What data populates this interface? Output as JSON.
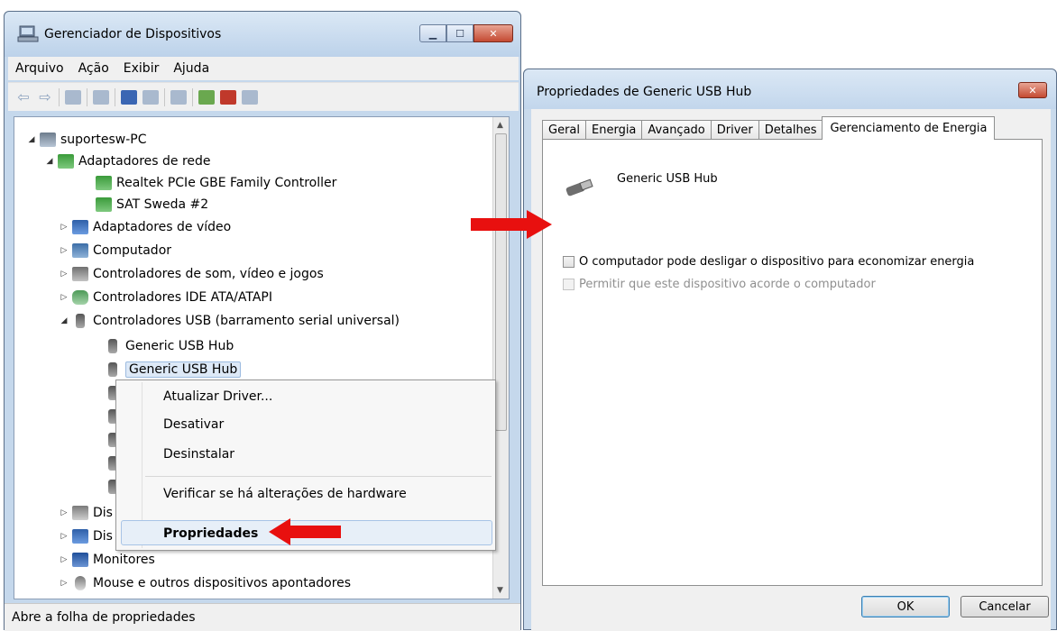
{
  "devmgr": {
    "title": "Gerenciador de Dispositivos",
    "menu": [
      "Arquivo",
      "Ação",
      "Exibir",
      "Ajuda"
    ],
    "tree": {
      "root": "suportesw-PC",
      "net_adapters": "Adaptadores de rede",
      "net_child1": "Realtek PCIe GBE Family Controller",
      "net_child2": "SAT Sweda #2",
      "video": "Adaptadores de vídeo",
      "computer": "Computador",
      "sound": "Controladores de som, vídeo e jogos",
      "ide": "Controladores IDE ATA/ATAPI",
      "usb": "Controladores USB (barramento serial universal)",
      "usb_child1": "Generic USB Hub",
      "usb_child2": "Generic USB Hub",
      "dis1": "Dis",
      "dis2": "Dis",
      "monitors": "Monitores",
      "mouse": "Mouse e outros dispositivos apontadores"
    },
    "status": "Abre a folha de propriedades"
  },
  "context_menu": {
    "items": [
      "Atualizar Driver...",
      "Desativar",
      "Desinstalar",
      "Verificar se há alterações de hardware",
      "Propriedades"
    ]
  },
  "props": {
    "title": "Propriedades de Generic USB Hub",
    "tabs": [
      "Geral",
      "Energia",
      "Avançado",
      "Driver",
      "Detalhes",
      "Gerenciamento de Energia"
    ],
    "device_name": "Generic USB Hub",
    "checkbox1": "O computador pode desligar o dispositivo para economizar energia",
    "checkbox2": "Permitir que este dispositivo acorde o computador",
    "ok": "OK",
    "cancel": "Cancelar"
  },
  "colors": {
    "arrow": "#e8100f",
    "selection": "#dde9f7"
  }
}
